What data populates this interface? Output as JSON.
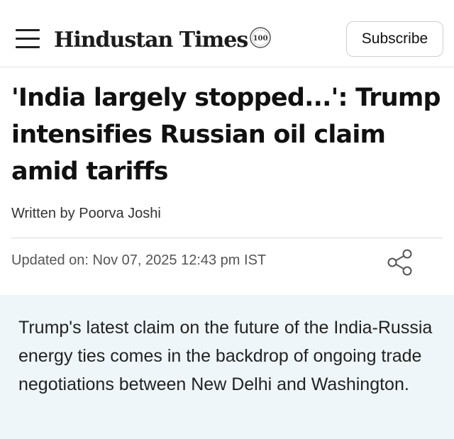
{
  "header": {
    "logo_text": "Hindustan Times",
    "badge_text": "100",
    "subscribe_label": "Subscribe"
  },
  "article": {
    "headline": "'India largely stopped...': Trump intensifies Russian oil claim amid tariffs",
    "byline_prefix": "Written by",
    "author": "Poorva Joshi",
    "updated_label": "Updated on:",
    "updated_value": "Nov 07, 2025 12:43 pm IST",
    "summary": "Trump's latest claim on the future of the India-Russia energy ties comes in the backdrop of ongoing trade negotiations between New Delhi and Washington."
  },
  "icons": {
    "menu": "hamburger-menu-icon",
    "share": "share-icon"
  },
  "colors": {
    "summary_background": "#eef6f9",
    "text": "#111111",
    "muted_text": "#555555"
  }
}
